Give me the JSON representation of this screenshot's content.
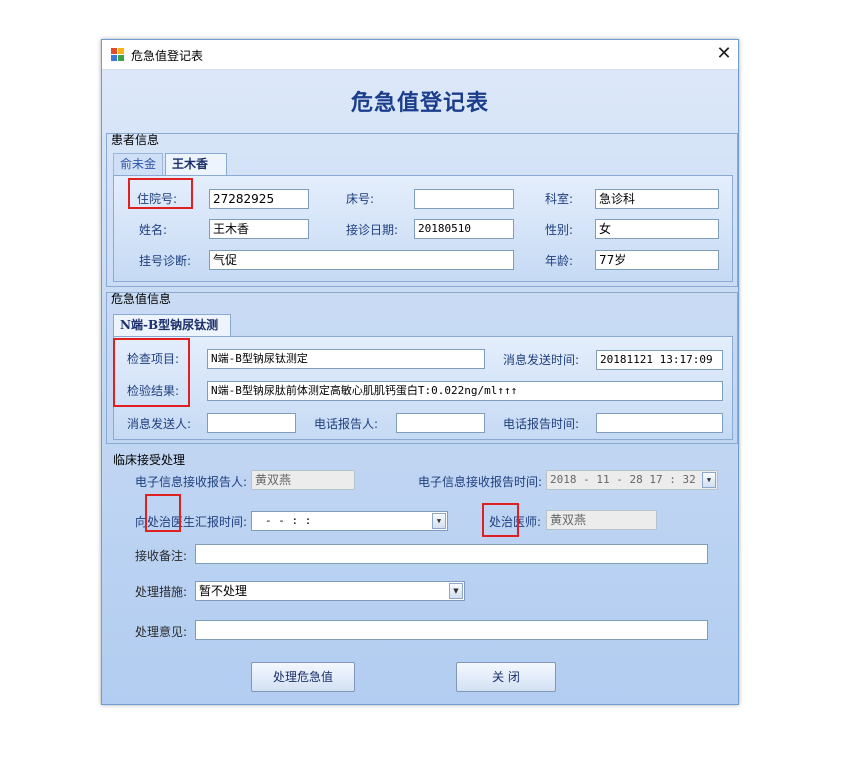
{
  "window": {
    "title": "危急值登记表",
    "heading": "危急值登记表",
    "close_glyph": "✕"
  },
  "patient": {
    "group_label": "患者信息",
    "tabs": [
      {
        "label": "俞未金",
        "active": false
      },
      {
        "label": "王木香",
        "active": true
      }
    ],
    "inpatient_no": {
      "label": "住院号:",
      "value": "27282925"
    },
    "bed_no": {
      "label": "床号:",
      "value": ""
    },
    "department": {
      "label": "科室:",
      "value": "急诊科"
    },
    "name": {
      "label": "姓名:",
      "value": "王木香"
    },
    "visit_date": {
      "label": "接诊日期:",
      "value": "20180510"
    },
    "gender": {
      "label": "性别:",
      "value": "女"
    },
    "registration_diagnosis": {
      "label": "挂号诊断:",
      "value": "气促"
    },
    "age": {
      "label": "年龄:",
      "value": "77岁"
    }
  },
  "critical": {
    "group_label": "危急值信息",
    "tabs": [
      {
        "label": "N端-B型钠尿钛测定",
        "active": true
      }
    ],
    "exam_item": {
      "label": "检查项目:",
      "value": "N端-B型钠尿钛测定"
    },
    "send_time": {
      "label": "消息发送时间:",
      "value": "20181121 13:17:09"
    },
    "test_result": {
      "label": "检验结果:",
      "value": "N端-B型钠尿肽前体测定高敏心肌肌钙蛋白T:0.022ng/ml↑↑↑"
    },
    "sender": {
      "label": "消息发送人:",
      "value": ""
    },
    "phone_reporter": {
      "label": "电话报告人:",
      "value": ""
    },
    "phone_report_time": {
      "label": "电话报告时间:",
      "value": ""
    }
  },
  "clinical": {
    "section_label": "临床接受处理",
    "e_receiver": {
      "label": "电子信息接收报告人:",
      "value": "黄双燕"
    },
    "e_receive_time": {
      "label": "电子信息接收报告时间:",
      "value": "2018 - 11 - 28   17 : 32 :"
    },
    "report_time": {
      "label": "向处治医生汇报时间:",
      "value": "-   -        :    :"
    },
    "doctor": {
      "label": "处治医师:",
      "value": "黄双燕"
    },
    "receive_note": {
      "label": "接收备注:",
      "value": ""
    },
    "measure": {
      "label": "处理措施:",
      "value": "暂不处理",
      "options": [
        "暂不处理"
      ]
    },
    "opinion": {
      "label": "处理意见:",
      "value": ""
    }
  },
  "buttons": {
    "process": "处理危急值",
    "close": "关  闭"
  },
  "icons": {
    "dropdown": "▼"
  }
}
